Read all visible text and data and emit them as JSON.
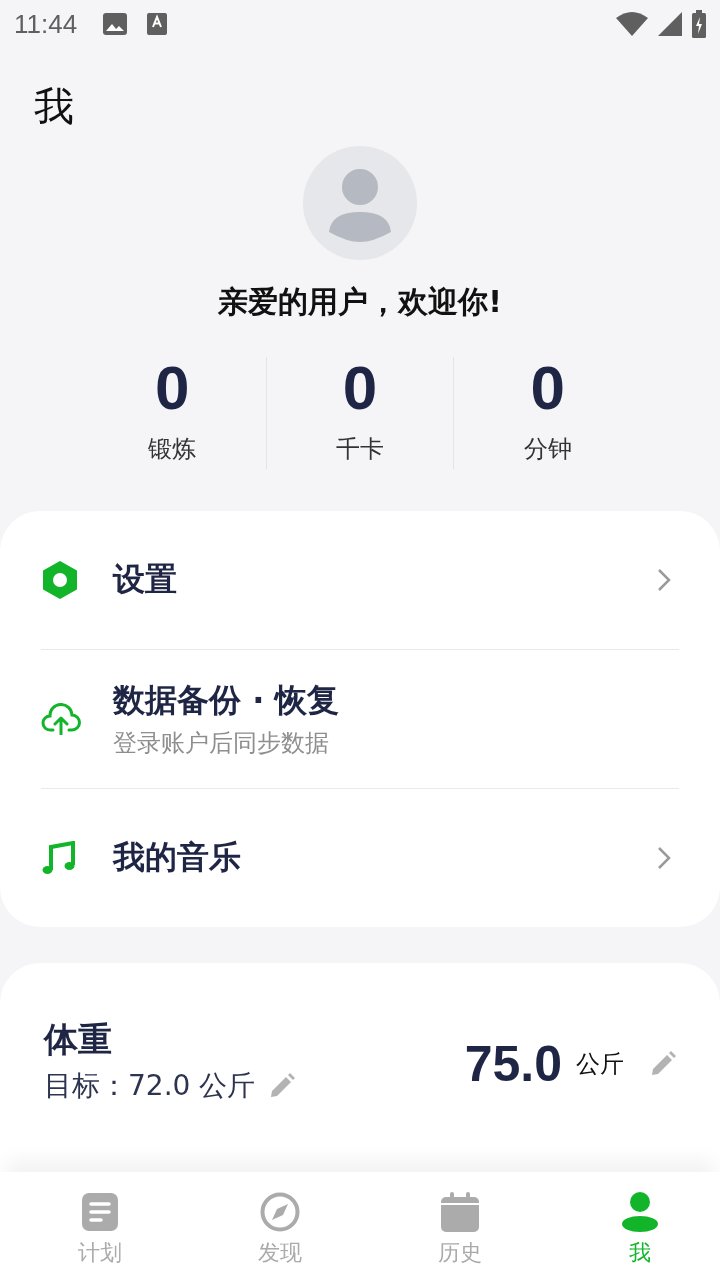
{
  "status_bar": {
    "time": "11:44"
  },
  "page_title": "我",
  "profile": {
    "greeting": "亲爱的用户，欢迎你!",
    "stats": [
      {
        "value": "0",
        "label": "锻炼"
      },
      {
        "value": "0",
        "label": "千卡"
      },
      {
        "value": "0",
        "label": "分钟"
      }
    ]
  },
  "menu": [
    {
      "kind": "link",
      "title": "设置"
    },
    {
      "kind": "subtitle",
      "title": "数据备份 · 恢复",
      "subtitle": "登录账户后同步数据"
    },
    {
      "kind": "link",
      "title": "我的音乐"
    }
  ],
  "weight": {
    "title": "体重",
    "goal": "目标：72.0 公斤",
    "value": "75.0",
    "unit": "公斤"
  },
  "bottom_nav": [
    {
      "label": "计划",
      "selected": false
    },
    {
      "label": "发现",
      "selected": false
    },
    {
      "label": "历史",
      "selected": false
    },
    {
      "label": "我",
      "selected": true
    }
  ]
}
